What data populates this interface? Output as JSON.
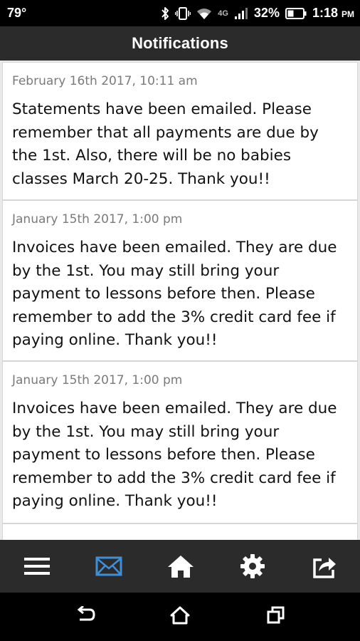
{
  "status_bar": {
    "temperature": "79°",
    "network": "4G",
    "battery": "32%",
    "time": "1:18",
    "ampm": "PM"
  },
  "header": {
    "title": "Notifications"
  },
  "notifications": [
    {
      "date": "February 16th 2017, 10:11 am",
      "message": "Statements have been emailed. Please remember that all payments are due by the 1st. Also, there will be no babies classes March 20-25. Thank you!!"
    },
    {
      "date": "January 15th 2017, 1:00 pm",
      "message": "Invoices have been emailed. They are due by the 1st. You may still bring your payment to lessons before then. Please remember to add the 3% credit card fee if paying online. Thank you!!"
    },
    {
      "date": "January 15th 2017, 1:00 pm",
      "message": "Invoices have been emailed. They are due by the 1st. You may still bring your payment to lessons before then. Please remember to add the 3% credit card fee if paying online. Thank you!!"
    }
  ],
  "bottom_nav": {
    "items": [
      {
        "icon": "menu-icon",
        "active": false
      },
      {
        "icon": "mail-icon",
        "active": true
      },
      {
        "icon": "home-icon",
        "active": false
      },
      {
        "icon": "gear-icon",
        "active": false
      },
      {
        "icon": "share-icon",
        "active": false
      }
    ],
    "active_color": "#3f8fd8",
    "icon_color": "#ffffff"
  },
  "system_nav": {
    "items": [
      "back-icon",
      "home-outline-icon",
      "recents-icon"
    ]
  }
}
